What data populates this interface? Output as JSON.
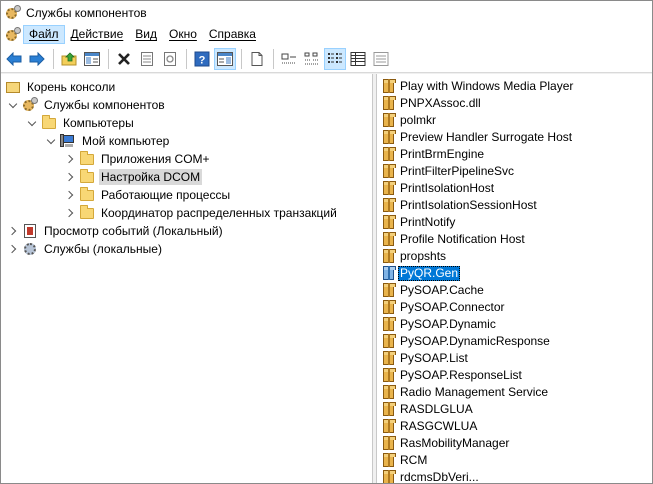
{
  "window": {
    "title": "Службы компонентов"
  },
  "menu": {
    "items": [
      {
        "label": "Файл",
        "active": true
      },
      {
        "label": "Действие",
        "active": false
      },
      {
        "label": "Вид",
        "active": false
      },
      {
        "label": "Окно",
        "active": false
      },
      {
        "label": "Справка",
        "active": false
      }
    ]
  },
  "toolbar": {
    "buttons": [
      "back-icon",
      "forward-icon",
      "up-folder-icon",
      "show-hide-tree-icon",
      "delete-icon",
      "properties-icon",
      "refresh-icon",
      "help-icon",
      "show-hide-action-pane-icon",
      "new-icon",
      "large-icons-view-icon",
      "small-icons-view-icon",
      "list-view-icon",
      "details-view-icon",
      "status-view-icon"
    ]
  },
  "tree": {
    "items": [
      {
        "label": "Корень консоли",
        "icon": "console-root-icon",
        "twisty": "none"
      },
      {
        "label": "Службы компонентов",
        "icon": "component-services-icon",
        "twisty": "expanded"
      },
      {
        "label": "Компьютеры",
        "icon": "folder-icon",
        "twisty": "expanded"
      },
      {
        "label": "Мой компьютер",
        "icon": "computer-icon",
        "twisty": "expanded"
      },
      {
        "label": "Приложения COM+",
        "icon": "folder-icon",
        "twisty": "collapsed"
      },
      {
        "label": "Настройка DCOM",
        "icon": "folder-icon",
        "twisty": "collapsed",
        "selected": true
      },
      {
        "label": "Работающие процессы",
        "icon": "folder-icon",
        "twisty": "collapsed"
      },
      {
        "label": "Координатор распределенных транзакций",
        "icon": "folder-icon",
        "twisty": "collapsed"
      },
      {
        "label": "Просмотр событий (Локальный)",
        "icon": "event-viewer-icon",
        "twisty": "collapsed"
      },
      {
        "label": "Службы (локальные)",
        "icon": "services-icon",
        "twisty": "collapsed"
      }
    ]
  },
  "list": {
    "items": [
      "Play with Windows Media Player",
      "PNPXAssoc.dll",
      "polmkr",
      "Preview Handler Surrogate Host",
      "PrintBrmEngine",
      "PrintFilterPipelineSvc",
      "PrintIsolationHost",
      "PrintIsolationSessionHost",
      "PrintNotify",
      "Profile Notification Host",
      "propshts",
      "PyQR.Gen",
      "PySOAP.Cache",
      "PySOAP.Connector",
      "PySOAP.Dynamic",
      "PySOAP.DynamicResponse",
      "PySOAP.List",
      "PySOAP.ResponseList",
      "Radio Management Service",
      "RASDLGLUA",
      "RASGCWLUA",
      "RasMobilityManager",
      "RCM",
      "rdcmsDbVeri..."
    ],
    "selected_label": "PyQR.Gen"
  },
  "colors": {
    "selection": "#0078d7",
    "tree_selection": "#d9d9d9",
    "menu_highlight": "#cce8ff"
  }
}
